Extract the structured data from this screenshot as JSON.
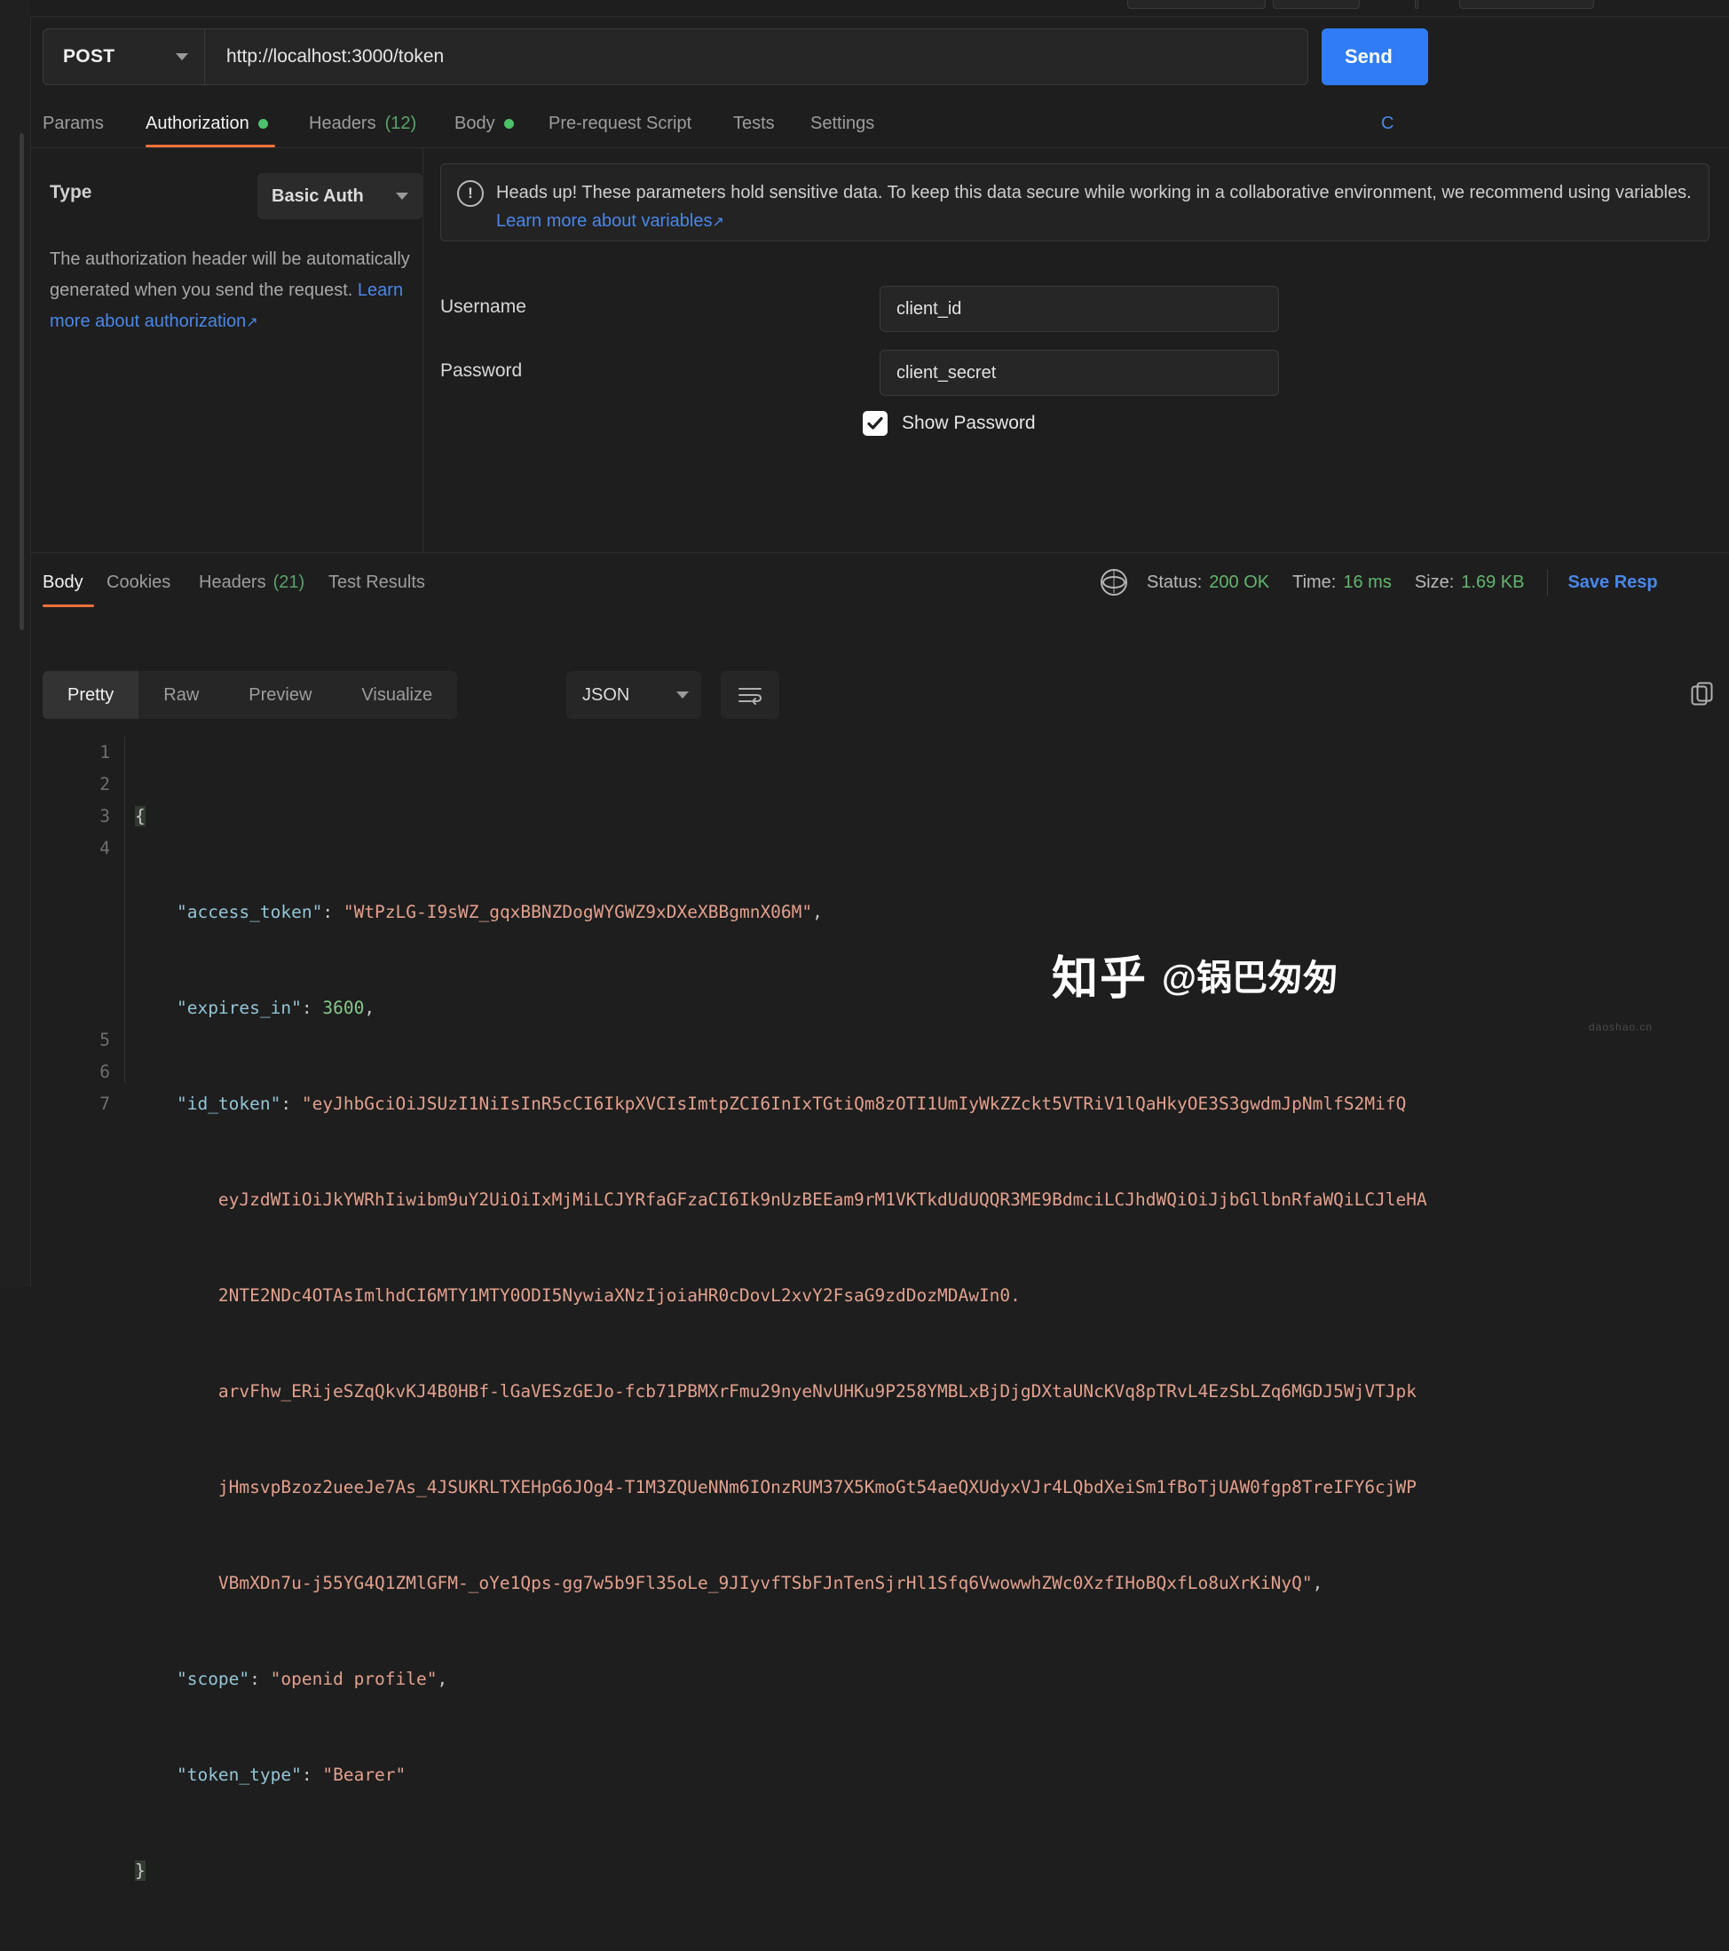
{
  "request": {
    "method": "POST",
    "url": "http://localhost:3000/token",
    "send_label": "Send",
    "tabs": [
      {
        "label": "Params",
        "active": false,
        "dot": false,
        "count": ""
      },
      {
        "label": "Authorization",
        "active": true,
        "dot": true,
        "count": ""
      },
      {
        "label": "Headers",
        "active": false,
        "dot": false,
        "count": "(12)"
      },
      {
        "label": "Body",
        "active": false,
        "dot": true,
        "count": ""
      },
      {
        "label": "Pre-request Script",
        "active": false,
        "dot": false,
        "count": ""
      },
      {
        "label": "Tests",
        "active": false,
        "dot": false,
        "count": ""
      },
      {
        "label": "Settings",
        "active": false,
        "dot": false,
        "count": ""
      }
    ],
    "cookies_link": "C"
  },
  "auth": {
    "type_label": "Type",
    "type_value": "Basic Auth",
    "description_part1": "The authorization header will be automatically generated when you send the request. ",
    "description_link": "Learn more about authorization",
    "link_arrow": "↗",
    "banner_text": "Heads up! These parameters hold sensitive data. To keep this data secure while working in a collaborative environment, we recommend using variables. ",
    "banner_link": "Learn more about variables",
    "banner_icon": "!",
    "username_label": "Username",
    "username_value": "client_id",
    "password_label": "Password",
    "password_value": "client_secret",
    "show_password_label": "Show Password",
    "show_password_checked": true
  },
  "response": {
    "tabs": [
      {
        "label": "Body",
        "active": true,
        "count": ""
      },
      {
        "label": "Cookies",
        "active": false,
        "count": ""
      },
      {
        "label": "Headers",
        "active": false,
        "count": "(21)"
      },
      {
        "label": "Test Results",
        "active": false,
        "count": ""
      }
    ],
    "status_label": "Status:",
    "status_value": "200 OK",
    "time_label": "Time:",
    "time_value": "16 ms",
    "size_label": "Size:",
    "size_value": "1.69 KB",
    "save_response": "Save Resp",
    "view_modes": [
      {
        "label": "Pretty",
        "active": true
      },
      {
        "label": "Raw",
        "active": false
      },
      {
        "label": "Preview",
        "active": false
      },
      {
        "label": "Visualize",
        "active": false
      }
    ],
    "format": "JSON",
    "line_numbers": [
      "1",
      "2",
      "3",
      "4",
      "5",
      "6",
      "7"
    ],
    "json": {
      "access_token": "WtPzLG-I9sWZ_gqxBBNZDogWYGWZ9xDXeXBBgmnX06M",
      "expires_in": "3600",
      "id_token_line1": "eyJhbGciOiJSUzI1NiIsInR5cCI6IkpXVCIsImtpZCI6InIxTGtiQm8zOTI1UmIyWkZZckt5VTRiV1lQaHkyOE3S3gwdmJpNmlfS2MifQ",
      "id_token_line2": "eyJzdWIiOiJkYWRhIiwibm9uY2UiOiIxMjMiLCJYRfaGFzaCI6Ik9nUzBEEam9rM1VKTkdUdUQQR3ME9BdmciLCJhdWQiOiJjbGllbnRfaWQiLCJleHA",
      "id_token_line3": "2NTE2NDc4OTAsImlhdCI6MTY1MTY0ODI5NywiaXNzIjoiaHR0cDovL2xvY2FsaG9zdDozMDAwIn0.",
      "id_token_line4": "arvFhw_ERijeSZqQkvKJ4B0HBf-lGaVESzGEJo-fcb71PBMXrFmu29nyeNvUHKu9P258YMBLxBjDjgDXtaUNcKVq8pTRvL4EzSbLZq6MGDJ5WjVTJpk",
      "id_token_line5": "jHmsvpBzoz2ueeJe7As_4JSUKRLTXEHpG6JOg4-T1M3ZQUeNNm6IOnzRUM37X5KmoGt54aeQXUdyxVJr4LQbdXeiSm1fBoTjUAW0fgp8TreIFY6cjWP",
      "id_token_line6": "VBmXDn7u-j55YG4Q1ZMlGFM-_oYe1Qps-gg7w5b9Fl35oLe_9JIyvfTSbFJnTenSjrHl1Sfq6VwowwhZWc0XzfIHoBQxfLo8uXrKiNyQ",
      "scope": "openid profile",
      "token_type": "Bearer"
    }
  },
  "watermark": {
    "logo": "知乎",
    "handle": "@锅巴匆匆",
    "footer": "daoshao.cn"
  },
  "colors": {
    "accent_orange": "#f0713a",
    "send_blue": "#2f7cf6",
    "link_blue": "#4a87e8",
    "success_green": "#62b56f",
    "bg": "#1e1e1e"
  }
}
